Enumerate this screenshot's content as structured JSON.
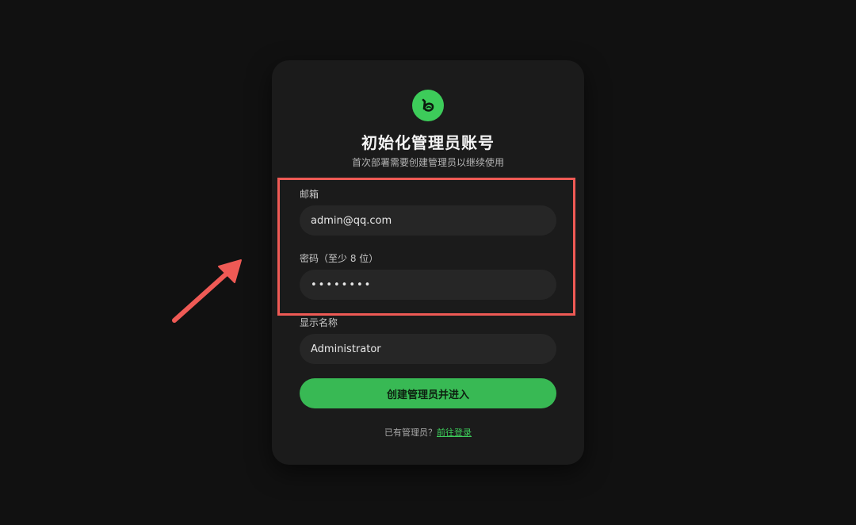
{
  "card": {
    "title": "初始化管理员账号",
    "subtitle": "首次部署需要创建管理员以继续使用"
  },
  "form": {
    "email_label": "邮箱",
    "email_value": "admin@qq.com",
    "password_label": "密码（至少 8 位）",
    "password_value": "••••••••",
    "display_name_label": "显示名称",
    "display_name_value": "Administrator",
    "submit_label": "创建管理员并进入"
  },
  "footer": {
    "prompt": "已有管理员？",
    "login_link": "前往登录"
  },
  "colors": {
    "accent": "#3dcc5a",
    "button": "#38b954",
    "annotation": "#ef5a55",
    "card_bg": "#1b1b1b",
    "page_bg": "#111111"
  },
  "icons": {
    "logo": "brand-logo-icon",
    "annotation_arrow": "arrow-icon"
  }
}
